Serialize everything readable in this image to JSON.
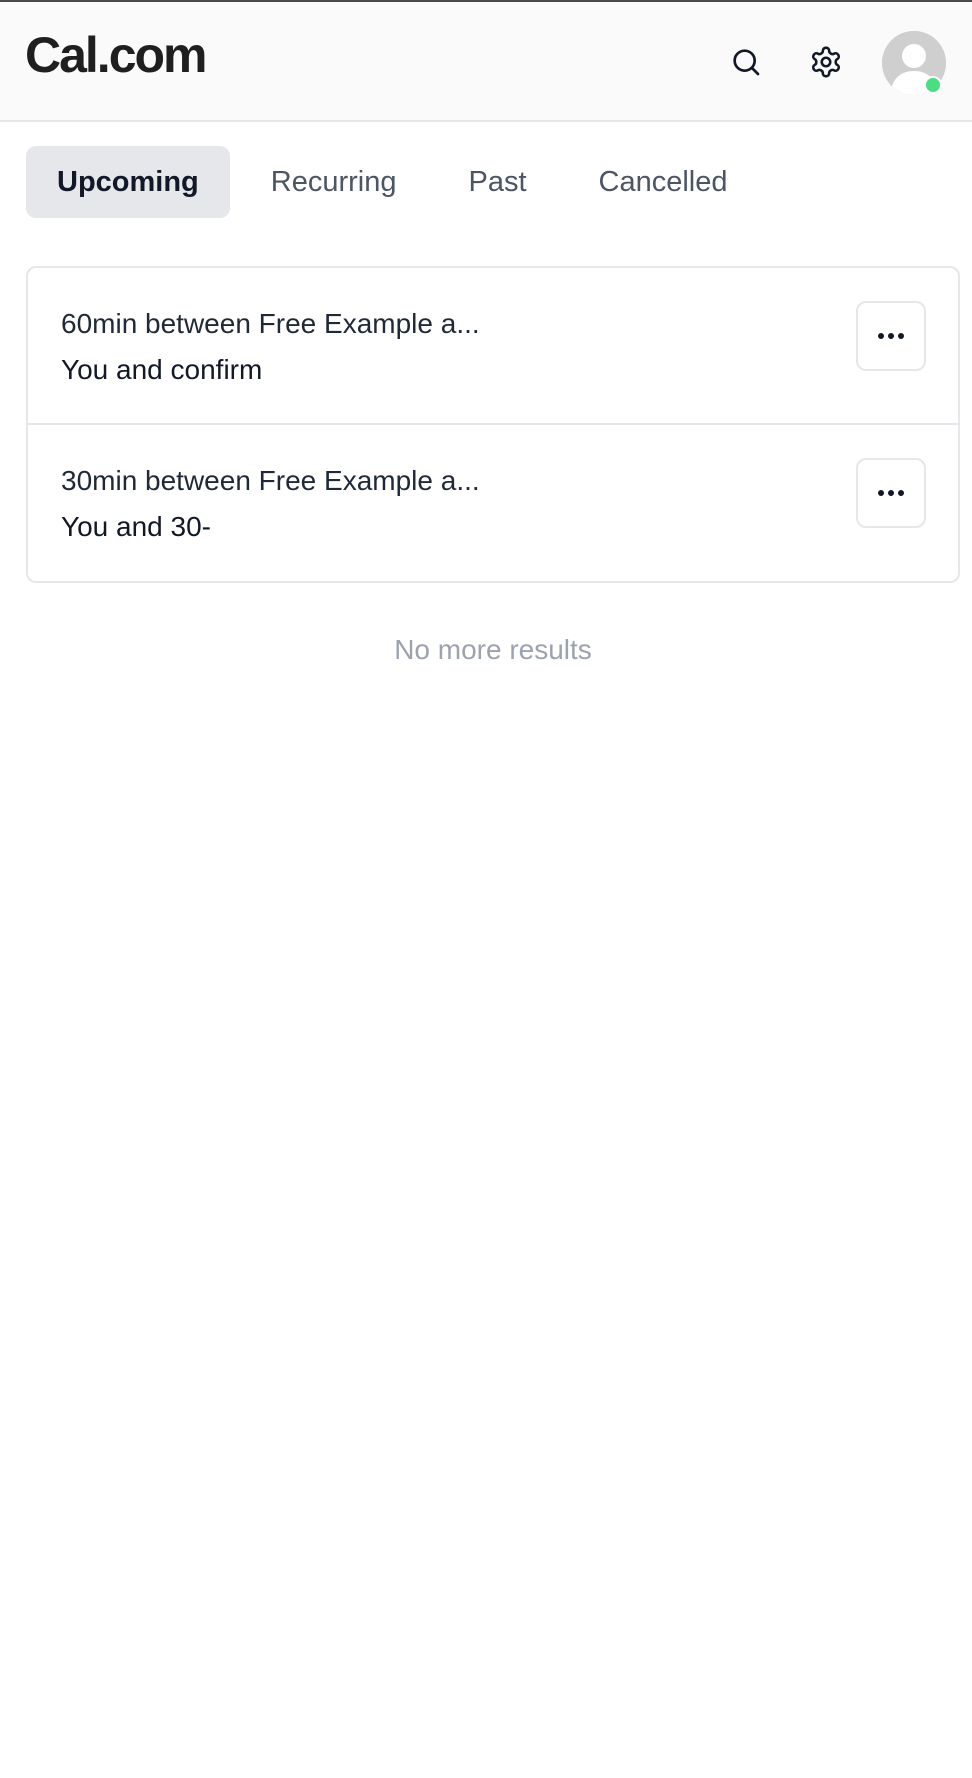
{
  "app": {
    "logo_text": "Cal.com"
  },
  "header": {
    "search_icon": "search-icon",
    "settings_icon": "gear-icon",
    "avatar_status": "online"
  },
  "tabs": [
    {
      "label": "Upcoming",
      "active": true
    },
    {
      "label": "Recurring",
      "active": false
    },
    {
      "label": "Past",
      "active": false
    },
    {
      "label": "Cancelled",
      "active": false
    }
  ],
  "bookings": [
    {
      "title": "60min between Free Example a...",
      "subtitle": "You and confirm"
    },
    {
      "title": "30min between Free Example a...",
      "subtitle": "You and 30-"
    }
  ],
  "footer_note": "No more results",
  "colors": {
    "active_tab_bg": "#e5e7eb",
    "status_online": "#4ade80",
    "muted_text": "#9ca3af"
  }
}
